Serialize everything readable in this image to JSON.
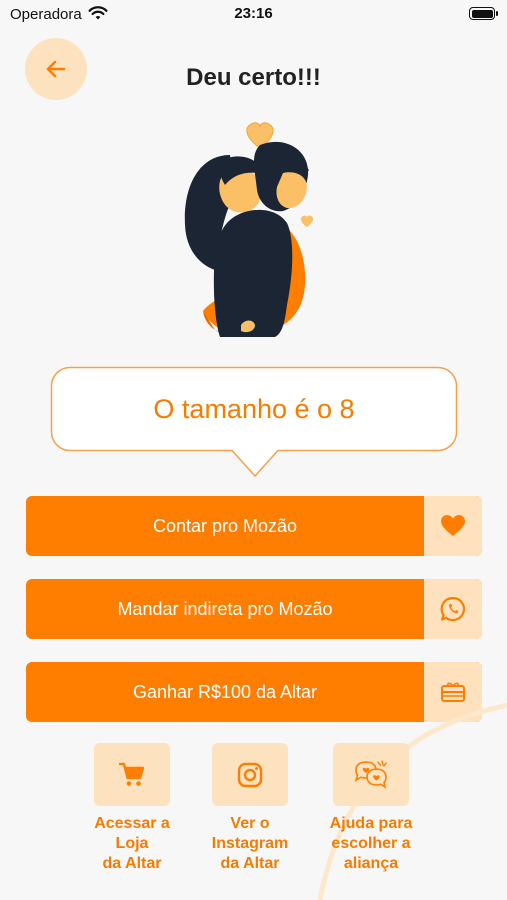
{
  "status_bar": {
    "carrier": "Operadora",
    "time": "23:16"
  },
  "header": {
    "title": "Deu certo!!!"
  },
  "result": {
    "text": "O tamanho é o 8"
  },
  "actions": [
    {
      "label": "Contar pro Mozão",
      "icon": "heart-icon"
    },
    {
      "label": "Mandar indireta pro Mozão",
      "icon": "whatsapp-icon"
    },
    {
      "label": "Ganhar R$100 da Altar",
      "icon": "gift-card-icon"
    }
  ],
  "shortcuts": [
    {
      "line1": "Acessar a",
      "line2": "Loja",
      "line3": "da Altar",
      "icon": "shopping-cart-icon"
    },
    {
      "line1": "Ver o",
      "line2": "Instagram",
      "line3": "da Altar",
      "icon": "instagram-icon"
    },
    {
      "line1": "Ajuda para",
      "line2": "escolher a",
      "line3": "aliança",
      "icon": "chat-hearts-icon"
    }
  ],
  "colors": {
    "accent": "#ff7e00",
    "accent_light": "#fde2bf",
    "text_accent": "#f57c00",
    "background": "#f7f7f7"
  }
}
